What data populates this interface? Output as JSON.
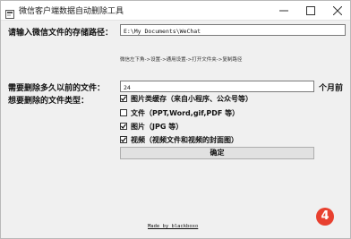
{
  "window": {
    "title": "微信客户端数据自动删除工具",
    "minimize_symbol": "—",
    "maximize_symbol": "☐",
    "close_symbol": "✕"
  },
  "form": {
    "path_label": "请输入微信文件的存储路径：",
    "path_value": "E:\\My Documents\\WeChat",
    "path_hint": "微信左下角->设置->通用设置->打开文件夹->复制路径",
    "days_label": "需要删除多久以前的文件：",
    "days_value": "24",
    "days_unit": "个月前",
    "types_label": "想要删除的文件类型：",
    "file_types": [
      {
        "label": "图片类缓存（来自小程序、公众号等）",
        "checked": true
      },
      {
        "label": "文件（PPT,Word,gif,PDF 等）",
        "checked": false
      },
      {
        "label": "图片（JPG 等）",
        "checked": true
      },
      {
        "label": "视频（视频文件和视频的封面图）",
        "checked": true
      }
    ],
    "confirm_label": "确定"
  },
  "footer": {
    "credit": "Made by blackboxo"
  },
  "badge": {
    "number": "4",
    "color": "#e8402f"
  },
  "icons": {
    "app": "app-icon",
    "checkmark": "checkmark-icon"
  }
}
